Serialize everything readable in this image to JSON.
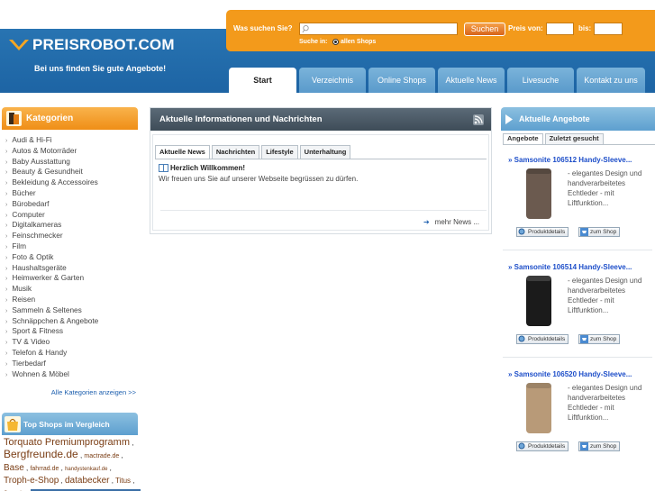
{
  "header": {
    "logo_text": "PREISROBOT.COM",
    "tagline": "Bei uns finden Sie gute Angebote!",
    "search": {
      "label": "Was suchen Sie?",
      "query": "",
      "button_label": "Suchen",
      "price_from_label": "Preis von:",
      "price_from_value": "",
      "price_to_label": "bis:",
      "price_to_value": "",
      "search_in_label": "Suche in:",
      "radio_label": "allen Shops"
    },
    "nav_tabs": [
      {
        "label": "Start",
        "active": true
      },
      {
        "label": "Verzeichnis"
      },
      {
        "label": "Online Shops"
      },
      {
        "label": "Aktuelle News"
      },
      {
        "label": "Livesuche"
      },
      {
        "label": "Kontakt zu uns"
      }
    ]
  },
  "categories": {
    "title": "Kategorien",
    "items": [
      "Audi & Hi-Fi",
      "Autos & Motorräder",
      "Baby Ausstattung",
      "Beauty & Gesundheit",
      "Bekleidung & Accessoires",
      "Bücher",
      "Bürobedarf",
      "Computer",
      "Digitalkameras",
      "Feinschmecker",
      "Film",
      "Foto & Optik",
      "Haushaltsgeräte",
      "Heimwerker & Garten",
      "Musik",
      "Reisen",
      "Sammeln & Seltenes",
      "Schnäppchen & Angebote",
      "Sport & Fitness",
      "TV & Video",
      "Telefon & Handy",
      "Tierbedarf",
      "Wohnen & Möbel"
    ],
    "all_link": "Alle Kategorien anzeigen >>"
  },
  "top_shops": {
    "title": "Top Shops im Vergleich",
    "shops": [
      {
        "name": "Torquato Premiumprogramm",
        "size": 11
      },
      {
        "name": "Bergfreunde.de",
        "size": 12
      },
      {
        "name": "mactrade.de",
        "size": 7
      },
      {
        "name": "Base",
        "size": 10
      },
      {
        "name": "fahrrad.de",
        "size": 7
      },
      {
        "name": "handystenkauf.de",
        "size": 6
      },
      {
        "name": "Troph-e-Shop",
        "size": 10
      },
      {
        "name": "databecker",
        "size": 10
      },
      {
        "name": "Titus",
        "size": 8
      },
      {
        "name": "Conrad",
        "size": 6
      }
    ]
  },
  "news": {
    "title": "Aktuelle Informationen und Nachrichten",
    "tabs": [
      {
        "label": "Aktuelle News",
        "active": true
      },
      {
        "label": "Nachrichten"
      },
      {
        "label": "Lifestyle"
      },
      {
        "label": "Unterhaltung"
      }
    ],
    "item_title": "Herzlich Willkommen!",
    "item_text": "Wir freuen uns Sie auf unserer Webseite begrüssen zu dürfen.",
    "more_link": "mehr News ..."
  },
  "offers": {
    "title": "Aktuelle Angebote",
    "tabs": [
      {
        "label": "Angebote",
        "active": true
      },
      {
        "label": "Zuletzt gesucht"
      }
    ],
    "items": [
      {
        "title": "» Samsonite 106512 Handy-Sleeve...",
        "description": "- elegantes Design und handverarbeitetes Echtleder - mit Liftfunktion...",
        "details_label": "Produktdetails",
        "shop_label": "zum Shop",
        "color": "#6b5a4f"
      },
      {
        "title": "» Samsonite 106514 Handy-Sleeve...",
        "description": "- elegantes Design und handverarbeitetes Echtleder - mit Liftfunktion...",
        "details_label": "Produktdetails",
        "shop_label": "zum Shop",
        "color": "#1b1b1b"
      },
      {
        "title": "» Samsonite 106520 Handy-Sleeve...",
        "description": "- elegantes Design und handverarbeitetes Echtleder - mit Liftfunktion...",
        "details_label": "Produktdetails",
        "shop_label": "zum Shop",
        "color": "#b89a78"
      }
    ]
  },
  "colors": {
    "brand_blue": "#2d7bb8",
    "accent_orange": "#f39a1b",
    "link_blue": "#1d4ec9",
    "shop_brown": "#7a3d14"
  }
}
